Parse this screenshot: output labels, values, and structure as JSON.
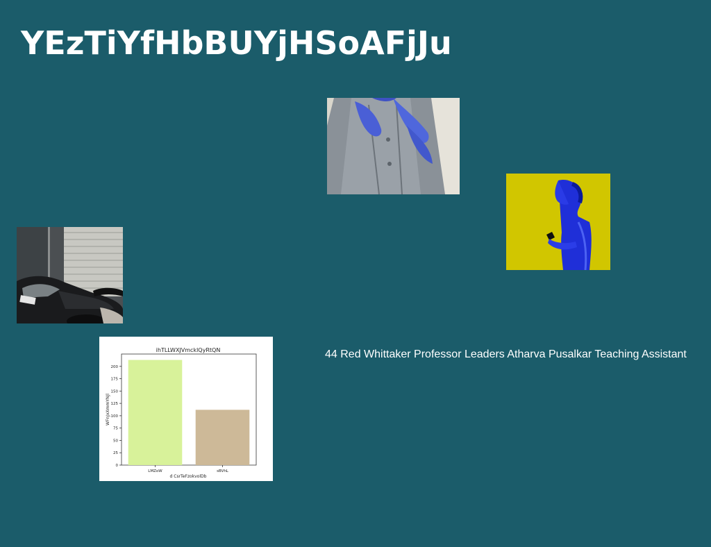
{
  "header": {
    "title": "YEzTiYfHbBUYjHSoAFjJu"
  },
  "photos": [
    {
      "subject": "person-hands-on-chest-photo"
    },
    {
      "subject": "person-using-phone-photo"
    },
    {
      "subject": "car-in-garage-photo"
    }
  ],
  "chart_data": {
    "type": "bar",
    "title": "ihTLLWXJVmcklQyRtQN",
    "xlabel": "d CsrTeFzokvolDb",
    "ylabel": "WFnJxXmmYNJl",
    "categories": [
      "LMZoW",
      "sBVhL"
    ],
    "values": [
      213,
      112
    ],
    "colors": [
      "#d8f29a",
      "#cdb998"
    ],
    "ylim": [
      0,
      225
    ],
    "yticks": [
      0,
      25,
      50,
      75,
      100,
      125,
      150,
      175,
      200
    ]
  },
  "caption": {
    "text": "44 Red Whittaker Professor Leaders Atharva Pusalkar Teaching Assistant"
  }
}
